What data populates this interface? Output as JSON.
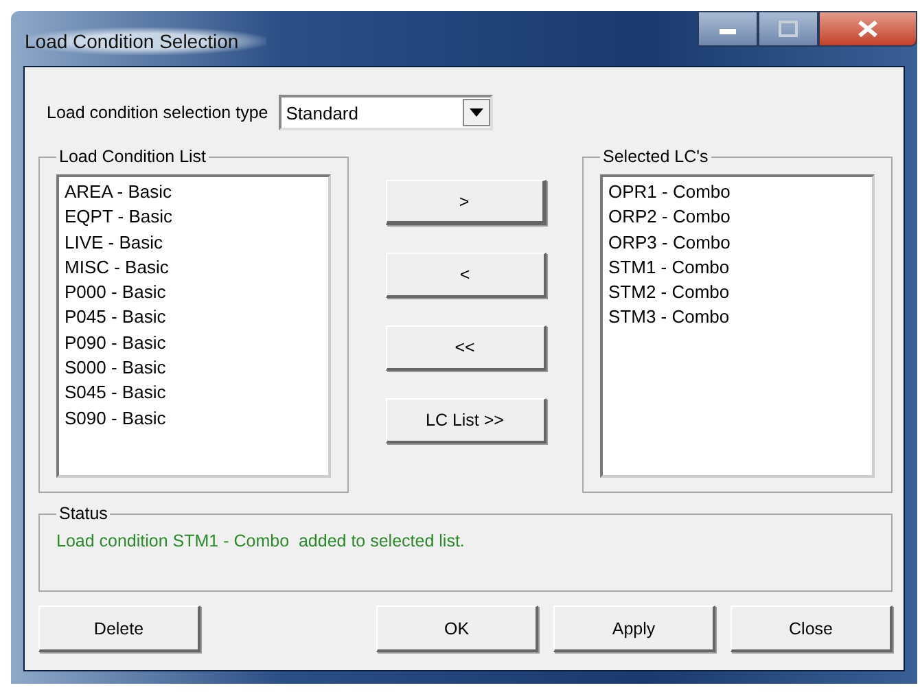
{
  "window": {
    "title": "Load Condition Selection"
  },
  "selection_type": {
    "label": "Load condition selection type",
    "value": "Standard"
  },
  "load_condition_list": {
    "title": "Load Condition List",
    "items": [
      "AREA - Basic",
      "EQPT - Basic",
      "LIVE - Basic",
      "MISC - Basic",
      "P000 - Basic",
      "P045 - Basic",
      "P090 - Basic",
      "S000 - Basic",
      "S045 - Basic",
      "S090 - Basic"
    ]
  },
  "move_buttons": [
    ">",
    "<",
    "<<",
    "LC List >>"
  ],
  "selected_lcs": {
    "title": "Selected LC's",
    "items": [
      "OPR1 - Combo",
      "ORP2 - Combo",
      "ORP3 - Combo",
      "STM1 - Combo",
      "STM2 - Combo",
      "STM3 - Combo"
    ]
  },
  "status": {
    "title": "Status",
    "message": "Load condition STM1 - Combo  added to selected list."
  },
  "buttons": {
    "left": [
      "Delete"
    ],
    "right": [
      "OK",
      "Apply",
      "Close"
    ]
  }
}
